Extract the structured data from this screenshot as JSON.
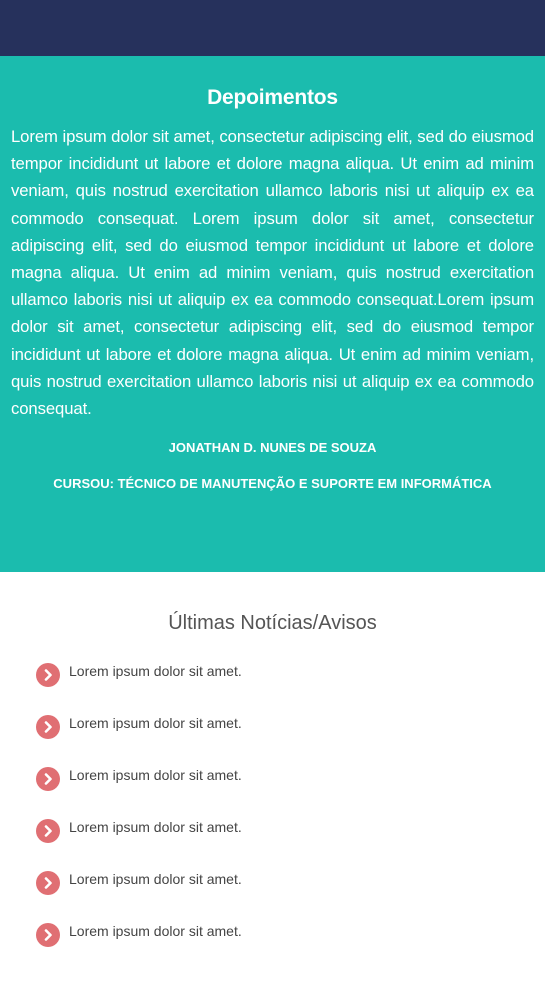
{
  "testimonials": {
    "title": "Depoimentos",
    "text": "Lorem ipsum dolor sit amet, consectetur adipiscing elit, sed do eiusmod tempor incididunt ut labore et dolore magna aliqua. Ut enim ad minim veniam, quis nostrud exercitation ullamco laboris nisi ut aliquip ex ea commodo consequat. Lorem ipsum dolor sit amet, consectetur adipiscing elit, sed do eiusmod tempor incididunt ut labore et dolore magna aliqua. Ut enim ad minim veniam, quis nostrud exercitation ullamco laboris nisi ut aliquip ex ea commodo consequat.Lorem ipsum dolor sit amet, consectetur adipiscing elit, sed do eiusmod tempor incididunt ut labore et dolore magna aliqua. Ut enim ad minim veniam, quis nostrud exercitation ullamco laboris nisi ut aliquip ex ea commodo consequat.",
    "author": "JONATHAN D. NUNES DE SOUZA",
    "course": "CURSOU: TÉCNICO DE MANUTENÇÃO E SUPORTE EM INFORMÁTICA"
  },
  "news": {
    "title": "Últimas Notícias/Avisos",
    "icon": "chevron-right-circle-icon",
    "items": [
      {
        "label": "Lorem ipsum dolor sit amet."
      },
      {
        "label": "Lorem ipsum dolor sit amet."
      },
      {
        "label": "Lorem ipsum dolor sit amet."
      },
      {
        "label": "Lorem ipsum dolor sit amet."
      },
      {
        "label": "Lorem ipsum dolor sit amet."
      },
      {
        "label": "Lorem ipsum dolor sit amet."
      }
    ]
  },
  "colors": {
    "header": "#26315c",
    "teal": "#1bbcae",
    "accent": "#e06f73"
  }
}
